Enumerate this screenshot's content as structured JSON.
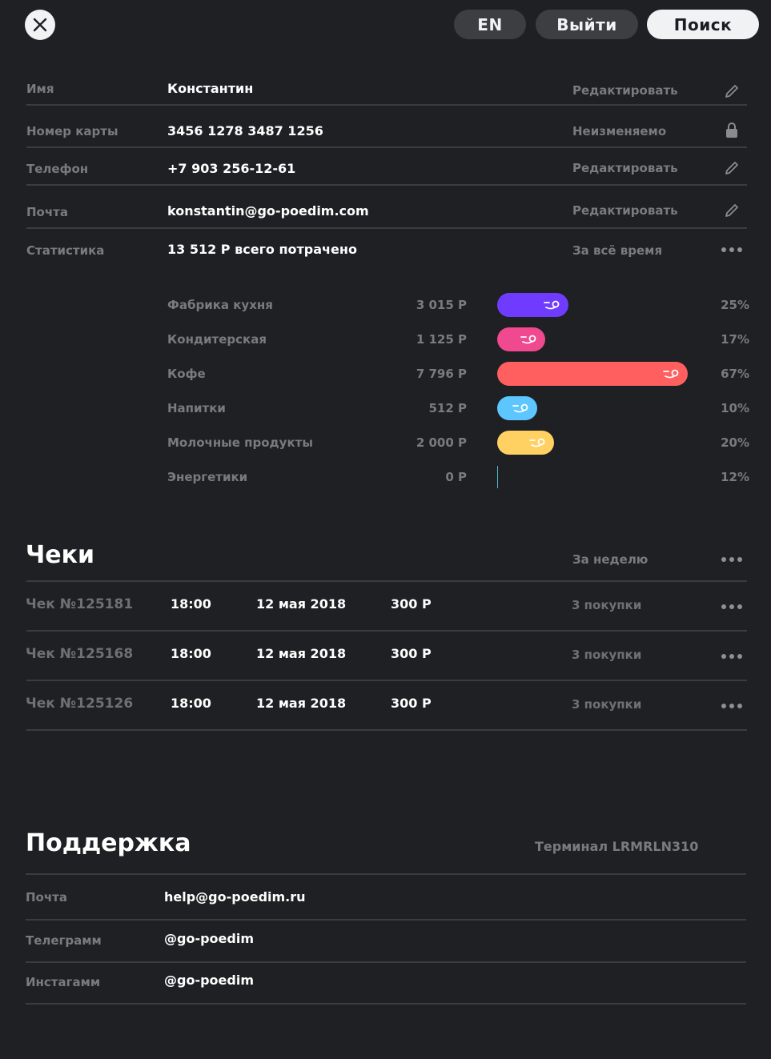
{
  "top_bar": {
    "lang_label": "EN",
    "logout_label": "Выйти",
    "search_label": "Поиск"
  },
  "profile": [
    {
      "label": "Имя",
      "value": "Константин",
      "action": "Редактировать",
      "icon": "pencil-icon"
    },
    {
      "label": "Номер карты",
      "value": "3456 1278 3487 1256",
      "action": "Неизменяемо",
      "icon": "lock-icon"
    },
    {
      "label": "Телефон",
      "value": "+7 903 256-12-61",
      "action": "Редактировать",
      "icon": "pencil-icon"
    },
    {
      "label": "Почта",
      "value": "konstantin@go-poedim.com",
      "action": "Редактировать",
      "icon": "pencil-icon"
    },
    {
      "label": "Статистика",
      "value": "13 512 Р всего потрачено",
      "action": "За всё время",
      "icon": "more-dots-icon"
    }
  ],
  "stats": [
    {
      "name": "Фабрика кухня",
      "amount": "3 015 Р",
      "percent": "25%",
      "bar_fill": 0.25,
      "color": "#6f3cff"
    },
    {
      "name": "Кондитерская",
      "amount": "1 125 Р",
      "percent": "17%",
      "bar_fill": 0.17,
      "color": "#f0498f"
    },
    {
      "name": "Кофе",
      "amount": "7 796 Р",
      "percent": "67%",
      "bar_fill": 0.67,
      "color": "#ff5f5f"
    },
    {
      "name": "Напитки",
      "amount": "512 Р",
      "percent": "10%",
      "bar_fill": 0.1,
      "color": "#5dc6ff"
    },
    {
      "name": "Молочные продукты",
      "amount": "2 000 Р",
      "percent": "20%",
      "bar_fill": 0.2,
      "color": "#ffd062"
    },
    {
      "name": "Энергетики",
      "amount": "0 Р",
      "percent": "12%",
      "bar_fill": 0.0,
      "color": "#4fb3c9"
    }
  ],
  "checks": {
    "title": "Чеки",
    "period": "За неделю",
    "rows": [
      {
        "label": "Чек №125181",
        "time": "18:00",
        "date": "12 мая 2018",
        "sum": "300 Р",
        "count": "3 покупки"
      },
      {
        "label": "Чек №125168",
        "time": "18:00",
        "date": "12 мая 2018",
        "sum": "300 Р",
        "count": "3 покупки"
      },
      {
        "label": "Чек №125126",
        "time": "18:00",
        "date": "12 мая 2018",
        "sum": "300 Р",
        "count": "3 покупки"
      }
    ]
  },
  "support": {
    "title": "Поддержка",
    "terminal": "Терминал LRMRLN310",
    "rows": [
      {
        "label": "Почта",
        "value": "help@go-poedim.ru"
      },
      {
        "label": "Телеграмм",
        "value": "@go-poedim"
      },
      {
        "label": "Инстагамм",
        "value": "@go-poedim"
      }
    ]
  }
}
